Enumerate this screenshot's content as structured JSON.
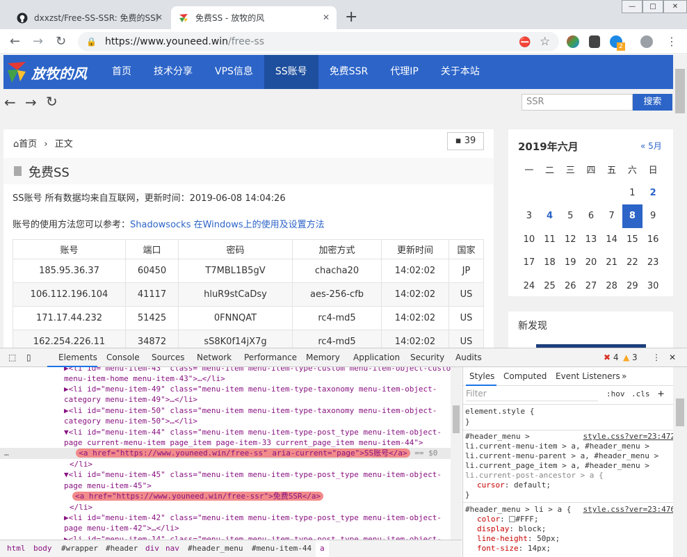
{
  "browser": {
    "tabs": [
      {
        "title": "dxxzst/Free-SS-SSR: 免费的SS账"
      },
      {
        "title": "免费SS - 放牧的风"
      }
    ],
    "new_tab": "+",
    "url_host": "https://www.youneed.win",
    "url_path": "/free-ss",
    "win_min": "—",
    "win_max": "□",
    "win_close": "✕",
    "ext_badge": "2"
  },
  "site": {
    "logo_text": "放牧的风",
    "menu": [
      {
        "label": "首页"
      },
      {
        "label": "技术分享"
      },
      {
        "label": "VPS信息"
      },
      {
        "label": "SS账号"
      },
      {
        "label": "免费SSR"
      },
      {
        "label": "代理IP"
      },
      {
        "label": "关于本站"
      }
    ],
    "search_placeholder": "SSR",
    "search_button": "搜索"
  },
  "post": {
    "crumb_home": "首页",
    "crumb_sep": "›",
    "crumb_current": "正文",
    "comment_count": "39",
    "title": "免费SS",
    "meta_line": "SS账号 所有数据均来自互联网，更新时间：2019-06-08 14:04:26",
    "usage_prefix": "账号的使用方法您可以参考：",
    "usage_link": "Shadowsocks 在Windows上的使用及设置方法"
  },
  "table": {
    "headers": [
      "账号",
      "端口",
      "密码",
      "加密方式",
      "更新时间",
      "国家"
    ],
    "rows": [
      [
        "185.95.36.37",
        "60450",
        "T7MBL1B5gV",
        "chacha20",
        "14:02:02",
        "JP"
      ],
      [
        "106.112.196.104",
        "41117",
        "hluR9stCaDsy",
        "aes-256-cfb",
        "14:02:02",
        "US"
      ],
      [
        "171.17.44.232",
        "51425",
        "0FNNQAT",
        "rc4-md5",
        "14:02:02",
        "US"
      ],
      [
        "162.254.226.11",
        "34872",
        "sS8K0f14jX7g",
        "rc4-md5",
        "14:02:02",
        "US"
      ]
    ]
  },
  "calendar": {
    "title": "2019年六月",
    "prev": "« 5月",
    "weekdays": [
      "一",
      "二",
      "三",
      "四",
      "五",
      "六",
      "日"
    ],
    "weeks": [
      [
        "",
        "",
        "",
        "",
        "",
        "1",
        "2"
      ],
      [
        "3",
        "4",
        "5",
        "6",
        "7",
        "8",
        "9"
      ],
      [
        "10",
        "11",
        "12",
        "13",
        "14",
        "15",
        "16"
      ],
      [
        "17",
        "18",
        "19",
        "20",
        "21",
        "22",
        "23"
      ],
      [
        "24",
        "25",
        "26",
        "27",
        "28",
        "29",
        "30"
      ]
    ],
    "linked_days": [
      "2",
      "4"
    ],
    "today": "8"
  },
  "sidebar": {
    "new_title": "新发现"
  },
  "devtools": {
    "tabs": [
      "Elements",
      "Console",
      "Sources",
      "Network",
      "Performance",
      "Memory",
      "Application",
      "Security",
      "Audits"
    ],
    "errors": "4",
    "warnings": "3",
    "dom_lines": [
      "▶<li id=\"menu-item-43\" class=\"menu-item menu-item-type-custom menu-item-object-custom",
      "menu-item-home menu-item-43\">…</li>",
      "▶<li id=\"menu-item-49\" class=\"menu-item menu-item-type-taxonomy menu-item-object-",
      "category menu-item-49\">…</li>",
      "▶<li id=\"menu-item-50\" class=\"menu-item menu-item-type-taxonomy menu-item-object-",
      "category menu-item-50\">…</li>",
      "▼<li id=\"menu-item-44\" class=\"menu-item menu-item-type-post_type menu-item-object-",
      "page current-menu-item page_item page-item-33 current_page_item menu-item-44\">",
      "<a href=\"https://www.youneed.win/free-ss\" aria-current=\"page\">SS账号</a>",
      "</li>",
      "▼<li id=\"menu-item-45\" class=\"menu-item menu-item-type-post_type menu-item-object-",
      "page menu-item-45\">",
      "<a href=\"https://www.youneed.win/free-ssr\">免费SSR</a>",
      "</li>",
      "▶<li id=\"menu-item-42\" class=\"menu-item menu-item-type-post_type menu-item-object-",
      "page menu-item-42\">…</li>",
      "▶<li id=\"menu-item-14\" class=\"menu-item menu-item-type-post_type menu-item-object-"
    ],
    "selected_suffix": "== $0",
    "breadcrumbs": [
      "html",
      "body",
      "#wrapper",
      "#header",
      "div",
      "nav",
      "#header_menu",
      "#menu-item-44",
      "a"
    ],
    "styles_tabs": [
      "Styles",
      "Computed",
      "Event Listeners",
      "»"
    ],
    "filter_placeholder": "Filter",
    "hov": ":hov",
    "cls": ".cls",
    "add": "+",
    "styles": {
      "element_style": "element.style {",
      "close": "}",
      "rule1_selectors": [
        "#header_menu >",
        "li.current-menu-item > a, #header_menu >",
        "li.current-menu-parent > a, #header_menu >",
        "li.current_page_item > a, #header_menu >",
        "li.current-post-ancestor > a {"
      ],
      "rule1_source": "style.css?ver=23:472",
      "rule1_prop": "cursor",
      "rule1_val": "default;",
      "rule2_selector": "#header_menu > li > a {",
      "rule2_source": "style.css?ver=23:476",
      "rule2_props": [
        {
          "p": "color",
          "v": "#FFF;"
        },
        {
          "p": "display",
          "v": "block;"
        },
        {
          "p": "line-height",
          "v": "50px;"
        },
        {
          "p": "font-size",
          "v": "14px;"
        }
      ]
    }
  }
}
